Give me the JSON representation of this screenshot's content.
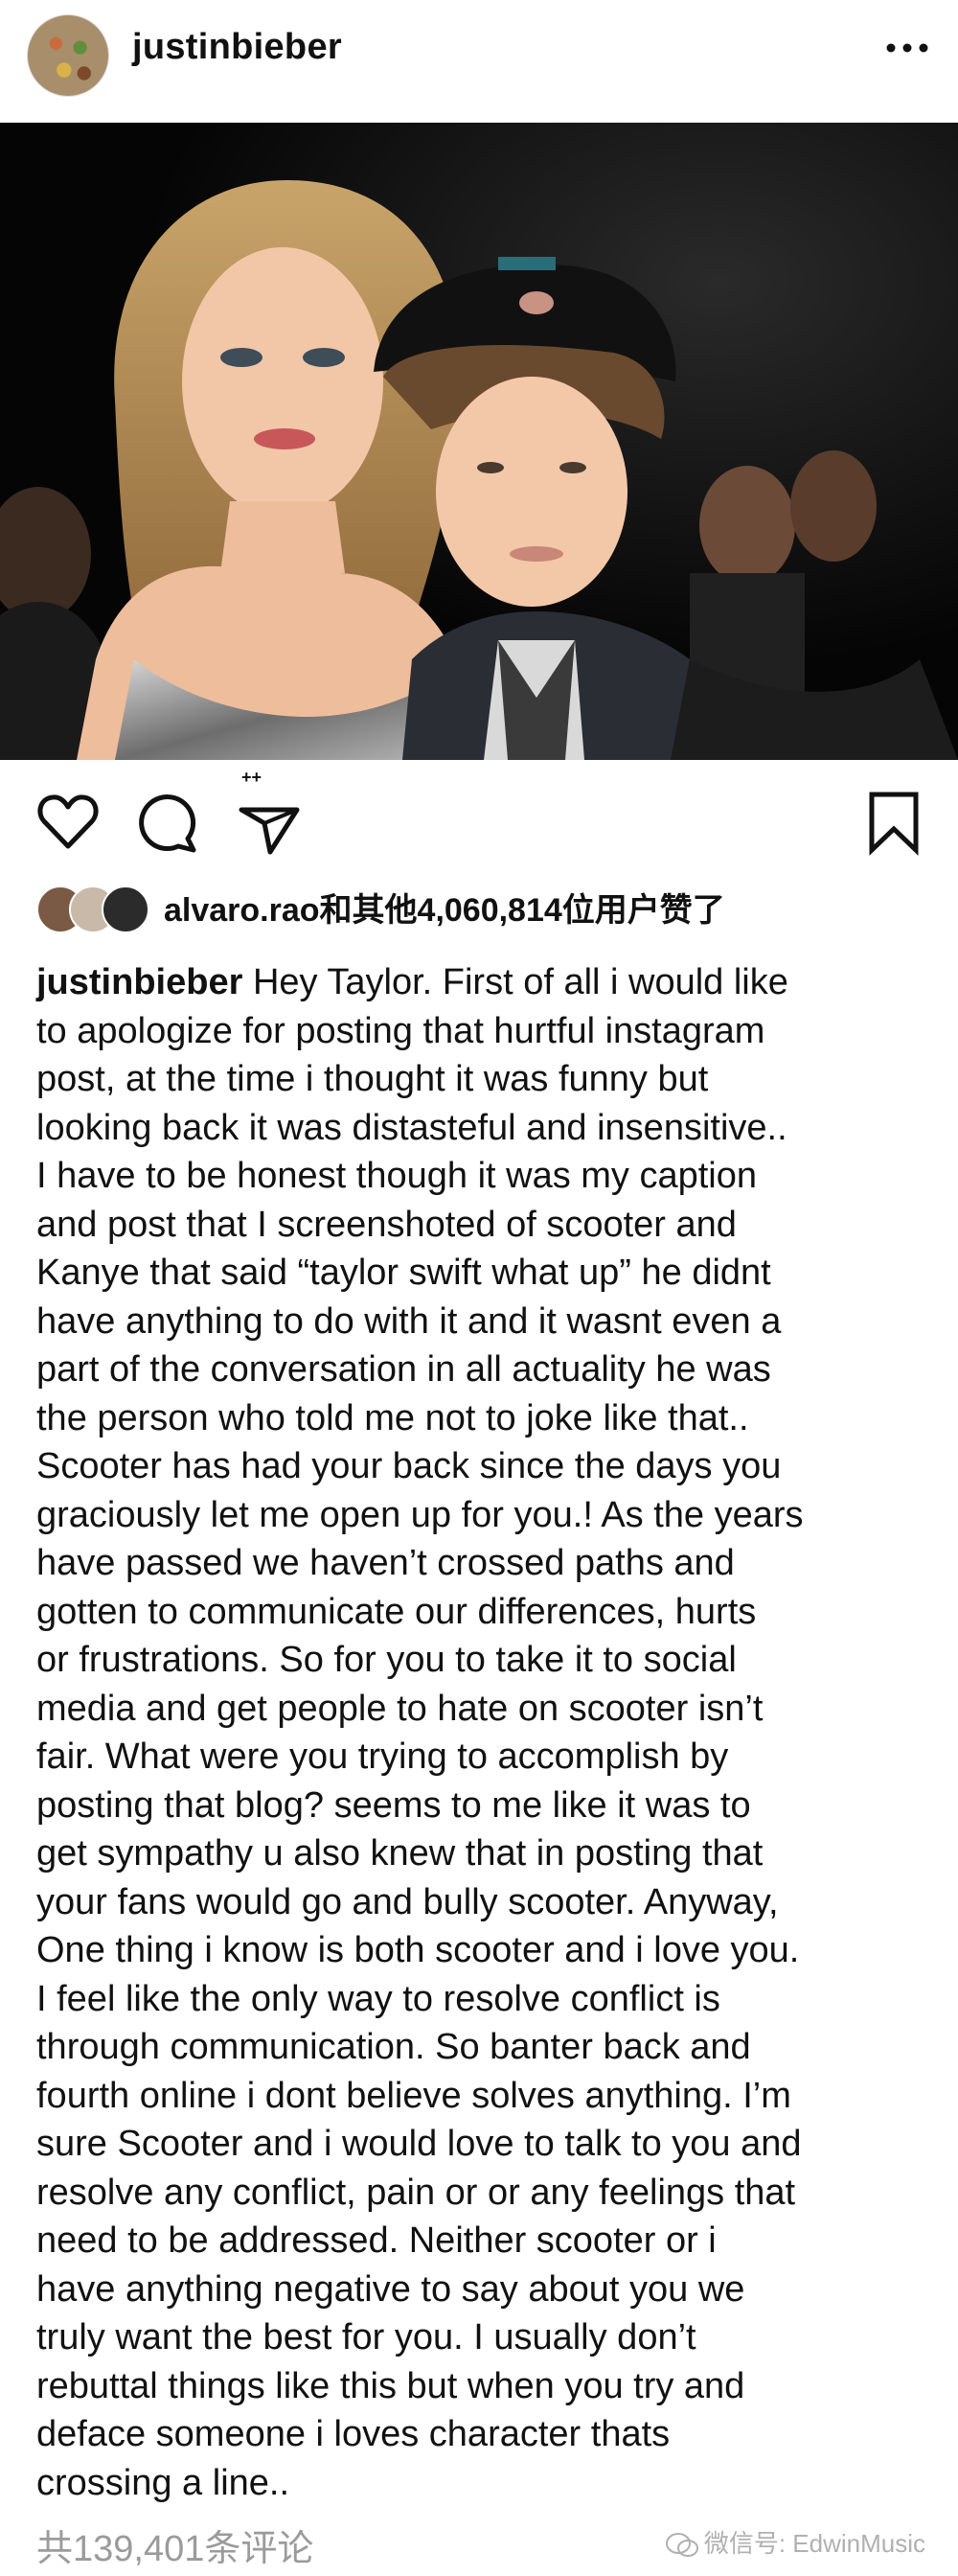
{
  "header": {
    "username": "justinbieber",
    "more_icon": "more-horizontal-icon"
  },
  "photo": {
    "description_icon": "post-photo"
  },
  "actions": {
    "icons": [
      "heart-icon",
      "comment-icon",
      "share-icon",
      "bookmark-icon"
    ],
    "share_badge": "++"
  },
  "likes": {
    "text": "alvaro.rao和其他4,060,814位用户赞了"
  },
  "caption": {
    "username": "justinbieber",
    "lines": [
      "Hey Taylor. First of all i would like",
      "to apologize for posting that hurtful instagram",
      "post, at the time i thought it was funny but",
      "looking back it was distasteful and insensitive..",
      "I have to be honest though it was my caption",
      "and post that I screenshoted of scooter and",
      "Kanye that said “taylor swift what up” he didnt",
      "have anything to do with it and it wasnt even a",
      "part of the conversation in all actuality he was",
      "the person who told me not to joke like that..",
      "Scooter has had your back since the days you",
      "graciously let me open up for you.! As the years",
      "have passed we haven’t crossed paths and",
      "gotten to communicate our differences, hurts",
      "or frustrations. So for you to take it to social",
      "media and get people to hate on scooter isn’t",
      "fair. What were you trying to accomplish by",
      "posting that blog? seems to me like it was to",
      "get sympathy u also knew that in posting that",
      "your fans would go and bully scooter. Anyway,",
      "One thing i know is both scooter and i love you.",
      "I feel like the only way to resolve conflict is",
      "through communication. So banter back and",
      "fourth online i dont believe solves anything. I’m",
      "sure Scooter and i would love to talk to you and",
      "resolve any conflict, pain or or any feelings that",
      "need to be addressed. Neither scooter or i",
      "have anything negative to say about you we",
      "truly want the best for you. I usually don’t",
      "rebuttal things like this but when you try and",
      "deface someone i loves character thats",
      "crossing a line.."
    ]
  },
  "footer": {
    "comments": "共139,401条评论",
    "watermark": "微信号: EdwinMusic"
  }
}
